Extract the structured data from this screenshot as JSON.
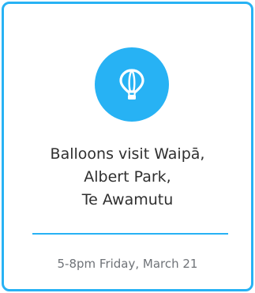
{
  "event": {
    "icon": "hot-air-balloon-icon",
    "title_lines": [
      "Balloons visit Waipā,",
      "Albert Park,",
      "Te Awamutu"
    ],
    "date": "5-8pm Friday, March 21"
  },
  "colors": {
    "accent": "#27b2f4",
    "title_text": "#2f2f2f",
    "date_text": "#6f7378"
  }
}
